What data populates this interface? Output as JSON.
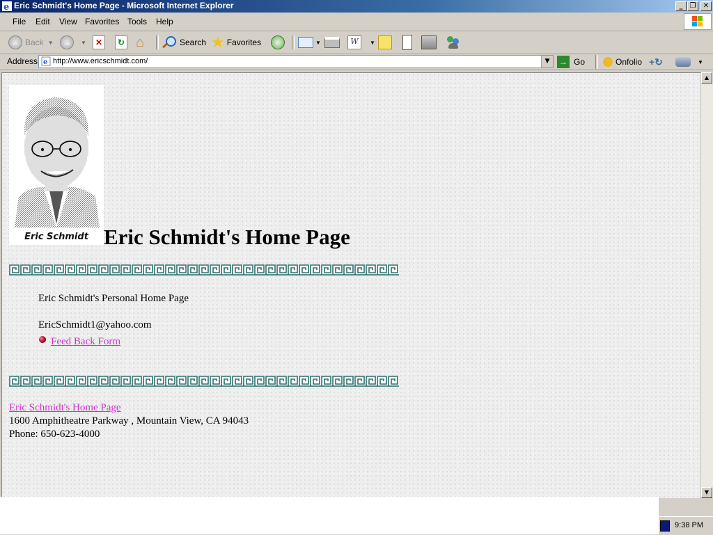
{
  "window": {
    "title": "Eric Schmidt's Home Page - Microsoft Internet Explorer",
    "controls": [
      "_",
      "❐",
      "✕"
    ]
  },
  "menu": [
    "File",
    "Edit",
    "View",
    "Favorites",
    "Tools",
    "Help"
  ],
  "toolbar": {
    "back_label": "Back",
    "search_label": "Search",
    "favorites_label": "Favorites"
  },
  "address": {
    "label": "Address",
    "url": "http://www.ericschmidt.com/",
    "go_label": "Go",
    "onfolio_label": "Onfolio"
  },
  "page": {
    "portrait_caption": "Eric Schmidt",
    "heading": "Eric Schmidt's Home Page",
    "intro": "Eric Schmidt's Personal Home Page",
    "email": "EricSchmidt1@yahoo.com",
    "feedback_link": "Feed Back Form",
    "footer_link": "Eric Schmidt's Home Page",
    "address_line": "1600 Amphitheatre Parkway , Mountain View, CA  94043",
    "phone_line": "Phone: 650-623-4000"
  },
  "colors": {
    "link": "#cc33cc",
    "greek_border": "#2f6f6a",
    "titlebar": "#0a246a"
  },
  "system": {
    "clock": "9:38 PM"
  }
}
